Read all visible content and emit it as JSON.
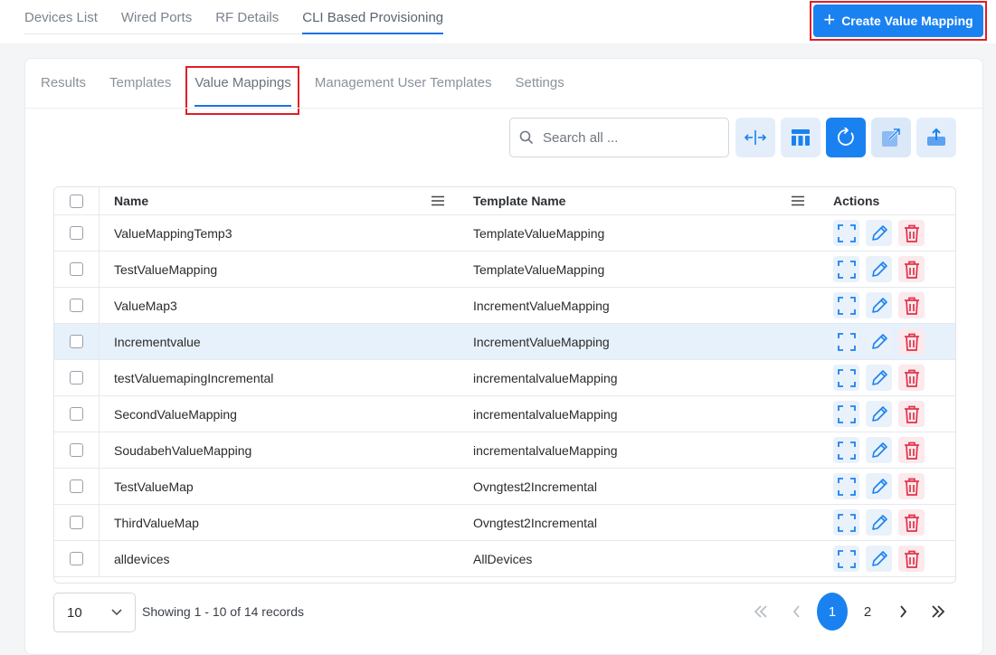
{
  "top_tabs": [
    "Devices List",
    "Wired Ports",
    "RF Details",
    "CLI Based Provisioning"
  ],
  "create_button": "Create Value Mapping",
  "sub_tabs": [
    "Results",
    "Templates",
    "Value Mappings",
    "Management User Templates",
    "Settings"
  ],
  "search": {
    "placeholder": "Search all ..."
  },
  "table": {
    "headers": {
      "name": "Name",
      "template": "Template Name",
      "actions": "Actions"
    },
    "rows": [
      {
        "name": "ValueMappingTemp3",
        "template": "TemplateValueMapping"
      },
      {
        "name": "TestValueMapping",
        "template": "TemplateValueMapping"
      },
      {
        "name": "ValueMap3",
        "template": "IncrementValueMapping"
      },
      {
        "name": "Incrementvalue",
        "template": "IncrementValueMapping"
      },
      {
        "name": "testValuemapingIncremental",
        "template": "incrementalvalueMapping"
      },
      {
        "name": "SecondValueMapping",
        "template": "incrementalvalueMapping"
      },
      {
        "name": "SoudabehValueMapping",
        "template": "incrementalvalueMapping"
      },
      {
        "name": "TestValueMap",
        "template": "Ovngtest2Incremental"
      },
      {
        "name": "ThirdValueMap",
        "template": "Ovngtest2Incremental"
      },
      {
        "name": "alldevices",
        "template": "AllDevices"
      }
    ]
  },
  "pagination": {
    "page_size": "10",
    "records_text": "Showing 1 - 10 of 14 records",
    "pages": [
      "1",
      "2"
    ]
  },
  "colors": {
    "accent": "#1a82f0",
    "highlight_border": "#e01f26",
    "delete": "#e0324a"
  }
}
